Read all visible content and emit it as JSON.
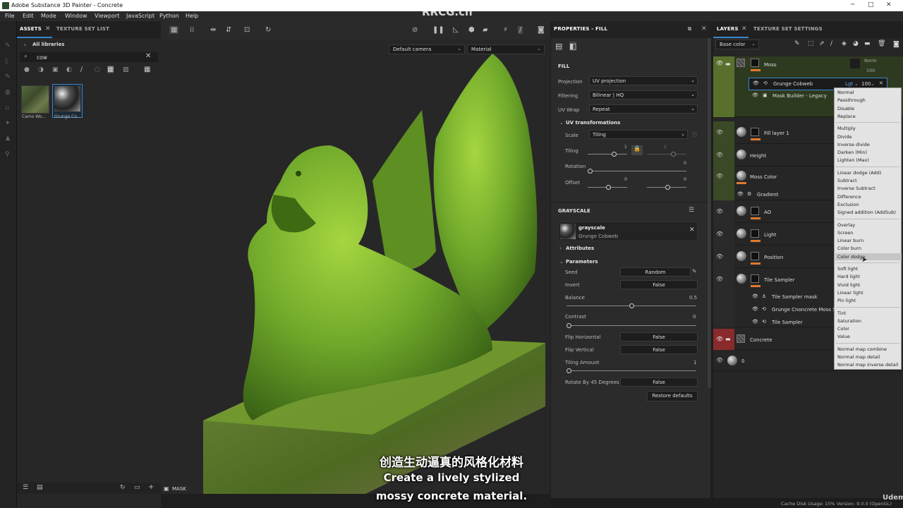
{
  "window": {
    "title": "Adobe Substance 3D Painter - Concrete",
    "watermark_top": "RRCG.cn"
  },
  "menu": [
    "File",
    "Edit",
    "Mode",
    "Window",
    "Viewport",
    "JavaScript",
    "Python",
    "Help"
  ],
  "assets": {
    "tabs": [
      "ASSETS",
      "TEXTURE SET LIST"
    ],
    "library": "All libraries",
    "search_value": "cow",
    "thumbnails": [
      "Camo Wo...",
      "Grunge Co..."
    ],
    "mask_label": "MASK"
  },
  "viewport": {
    "camera": "Default camera",
    "mode": "Material"
  },
  "properties": {
    "header": "PROPERTIES - FILL",
    "fill_section": "FILL",
    "projection_label": "Projection",
    "projection_value": "UV projection",
    "filtering_label": "Filtering",
    "filtering_value": "Bilinear | HQ",
    "uvwrap_label": "UV Wrap",
    "uvwrap_value": "Repeat",
    "uvtrans_label": "UV transformations",
    "scale_label": "Scale",
    "scale_value": "Tiling",
    "tiling_label": "Tiling",
    "tiling_v1": "1",
    "tiling_v2": "1",
    "rotation_label": "Rotation",
    "rotation_value": "0",
    "offset_label": "Offset",
    "offset_v1": "0",
    "offset_v2": "0",
    "grayscale_section": "GRAYSCALE",
    "gs_title": "grayscale",
    "gs_sub": "Grunge Cobweb",
    "attributes_label": "Attributes",
    "parameters_label": "Parameters",
    "seed_label": "Seed",
    "seed_value": "Random",
    "invert_label": "Invert",
    "invert_value": "False",
    "balance_label": "Balance",
    "balance_value": "0.5",
    "contrast_label": "Contrast",
    "contrast_value": "0",
    "fliph_label": "Flip Horizontal",
    "fliph_value": "False",
    "flipv_label": "Flip Vertical",
    "flipv_value": "False",
    "tiling_amount_label": "Tiling Amount",
    "tiling_amount_value": "1",
    "rotate45_label": "Rotate By 45 Degrees",
    "rotate45_value": "False",
    "restore_label": "Restore defaults"
  },
  "layers": {
    "tabs": [
      "LAYERS",
      "TEXTURE SET SETTINGS"
    ],
    "channel": "Base color",
    "norm_label": "Norm",
    "norm_value": "100",
    "items": [
      {
        "name": "Moss"
      },
      {
        "name": "Grunge Cobweb"
      },
      {
        "name": "Mask Builder - Legacy"
      },
      {
        "name": "Fill layer 1"
      },
      {
        "name": "Height"
      },
      {
        "name": "Moss Color"
      },
      {
        "name": "Gradient"
      },
      {
        "name": "AO"
      },
      {
        "name": "Light"
      },
      {
        "name": "Position"
      },
      {
        "name": "Tile Sampler"
      },
      {
        "name": "Tile Sampler mask"
      },
      {
        "name": "Grunge Cnoncrete Moss S..."
      },
      {
        "name": "Tile Sampler"
      },
      {
        "name": "Concrete"
      },
      {
        "name": "0"
      }
    ],
    "grunge_blend": "Lgt",
    "grunge_opacity": "100"
  },
  "blend_menu": {
    "groups": [
      [
        "Normal",
        "Passthrough",
        "Disable",
        "Replace"
      ],
      [
        "Multiply",
        "Divide",
        "Inverse divide",
        "Darken (Min)",
        "Lighten (Max)"
      ],
      [
        "Linear dodge (Add)",
        "Subtract",
        "Inverse Subtract",
        "Difference",
        "Exclusion",
        "Signed addition (AddSub)"
      ],
      [
        "Overlay",
        "Screen",
        "Linear burn",
        "Color burn",
        "Color dodge"
      ],
      [
        "Soft light",
        "Hard light",
        "Vivid light",
        "Linear light",
        "Pin light"
      ],
      [
        "Tint",
        "Saturation",
        "Color",
        "Value"
      ],
      [
        "Normal map combine",
        "Normal map detail",
        "Normal map inverse detail"
      ]
    ],
    "highlighted": "Color dodge"
  },
  "status": {
    "cache_label": "Cache Disk Usage:",
    "cache_value": "15%",
    "version": "Version: 9.0.0 (OpenGL)",
    "brand": "Udemy"
  },
  "subtitles": {
    "cn": "创造生动逼真的风格化材料",
    "en1": "Create a lively stylized",
    "en2": "mossy concrete material."
  },
  "colors": {
    "accent": "#3a86c8",
    "orange": "#e07a2c",
    "moss": "#6fa82a"
  }
}
